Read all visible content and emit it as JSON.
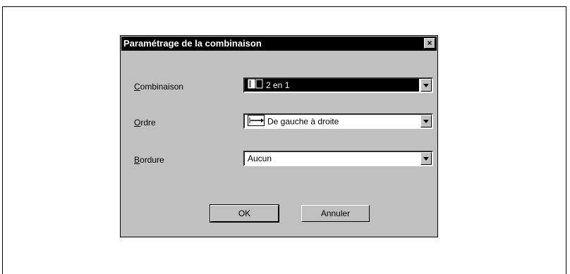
{
  "dialog": {
    "title": "Paramétrage de la combinaison",
    "close_glyph": "×"
  },
  "fields": [
    {
      "label_first": "C",
      "label_rest": "ombinaison",
      "value": "2 en 1",
      "icon": "page-layout-icon"
    },
    {
      "label_first": "O",
      "label_rest": "rdre",
      "value": "De gauche à droite",
      "icon": "left-to-right-arrow-icon"
    },
    {
      "label_first": "B",
      "label_rest": "ordure",
      "value": "Aucun",
      "icon": ""
    }
  ],
  "buttons": {
    "ok": "OK",
    "cancel": "Annuler"
  }
}
